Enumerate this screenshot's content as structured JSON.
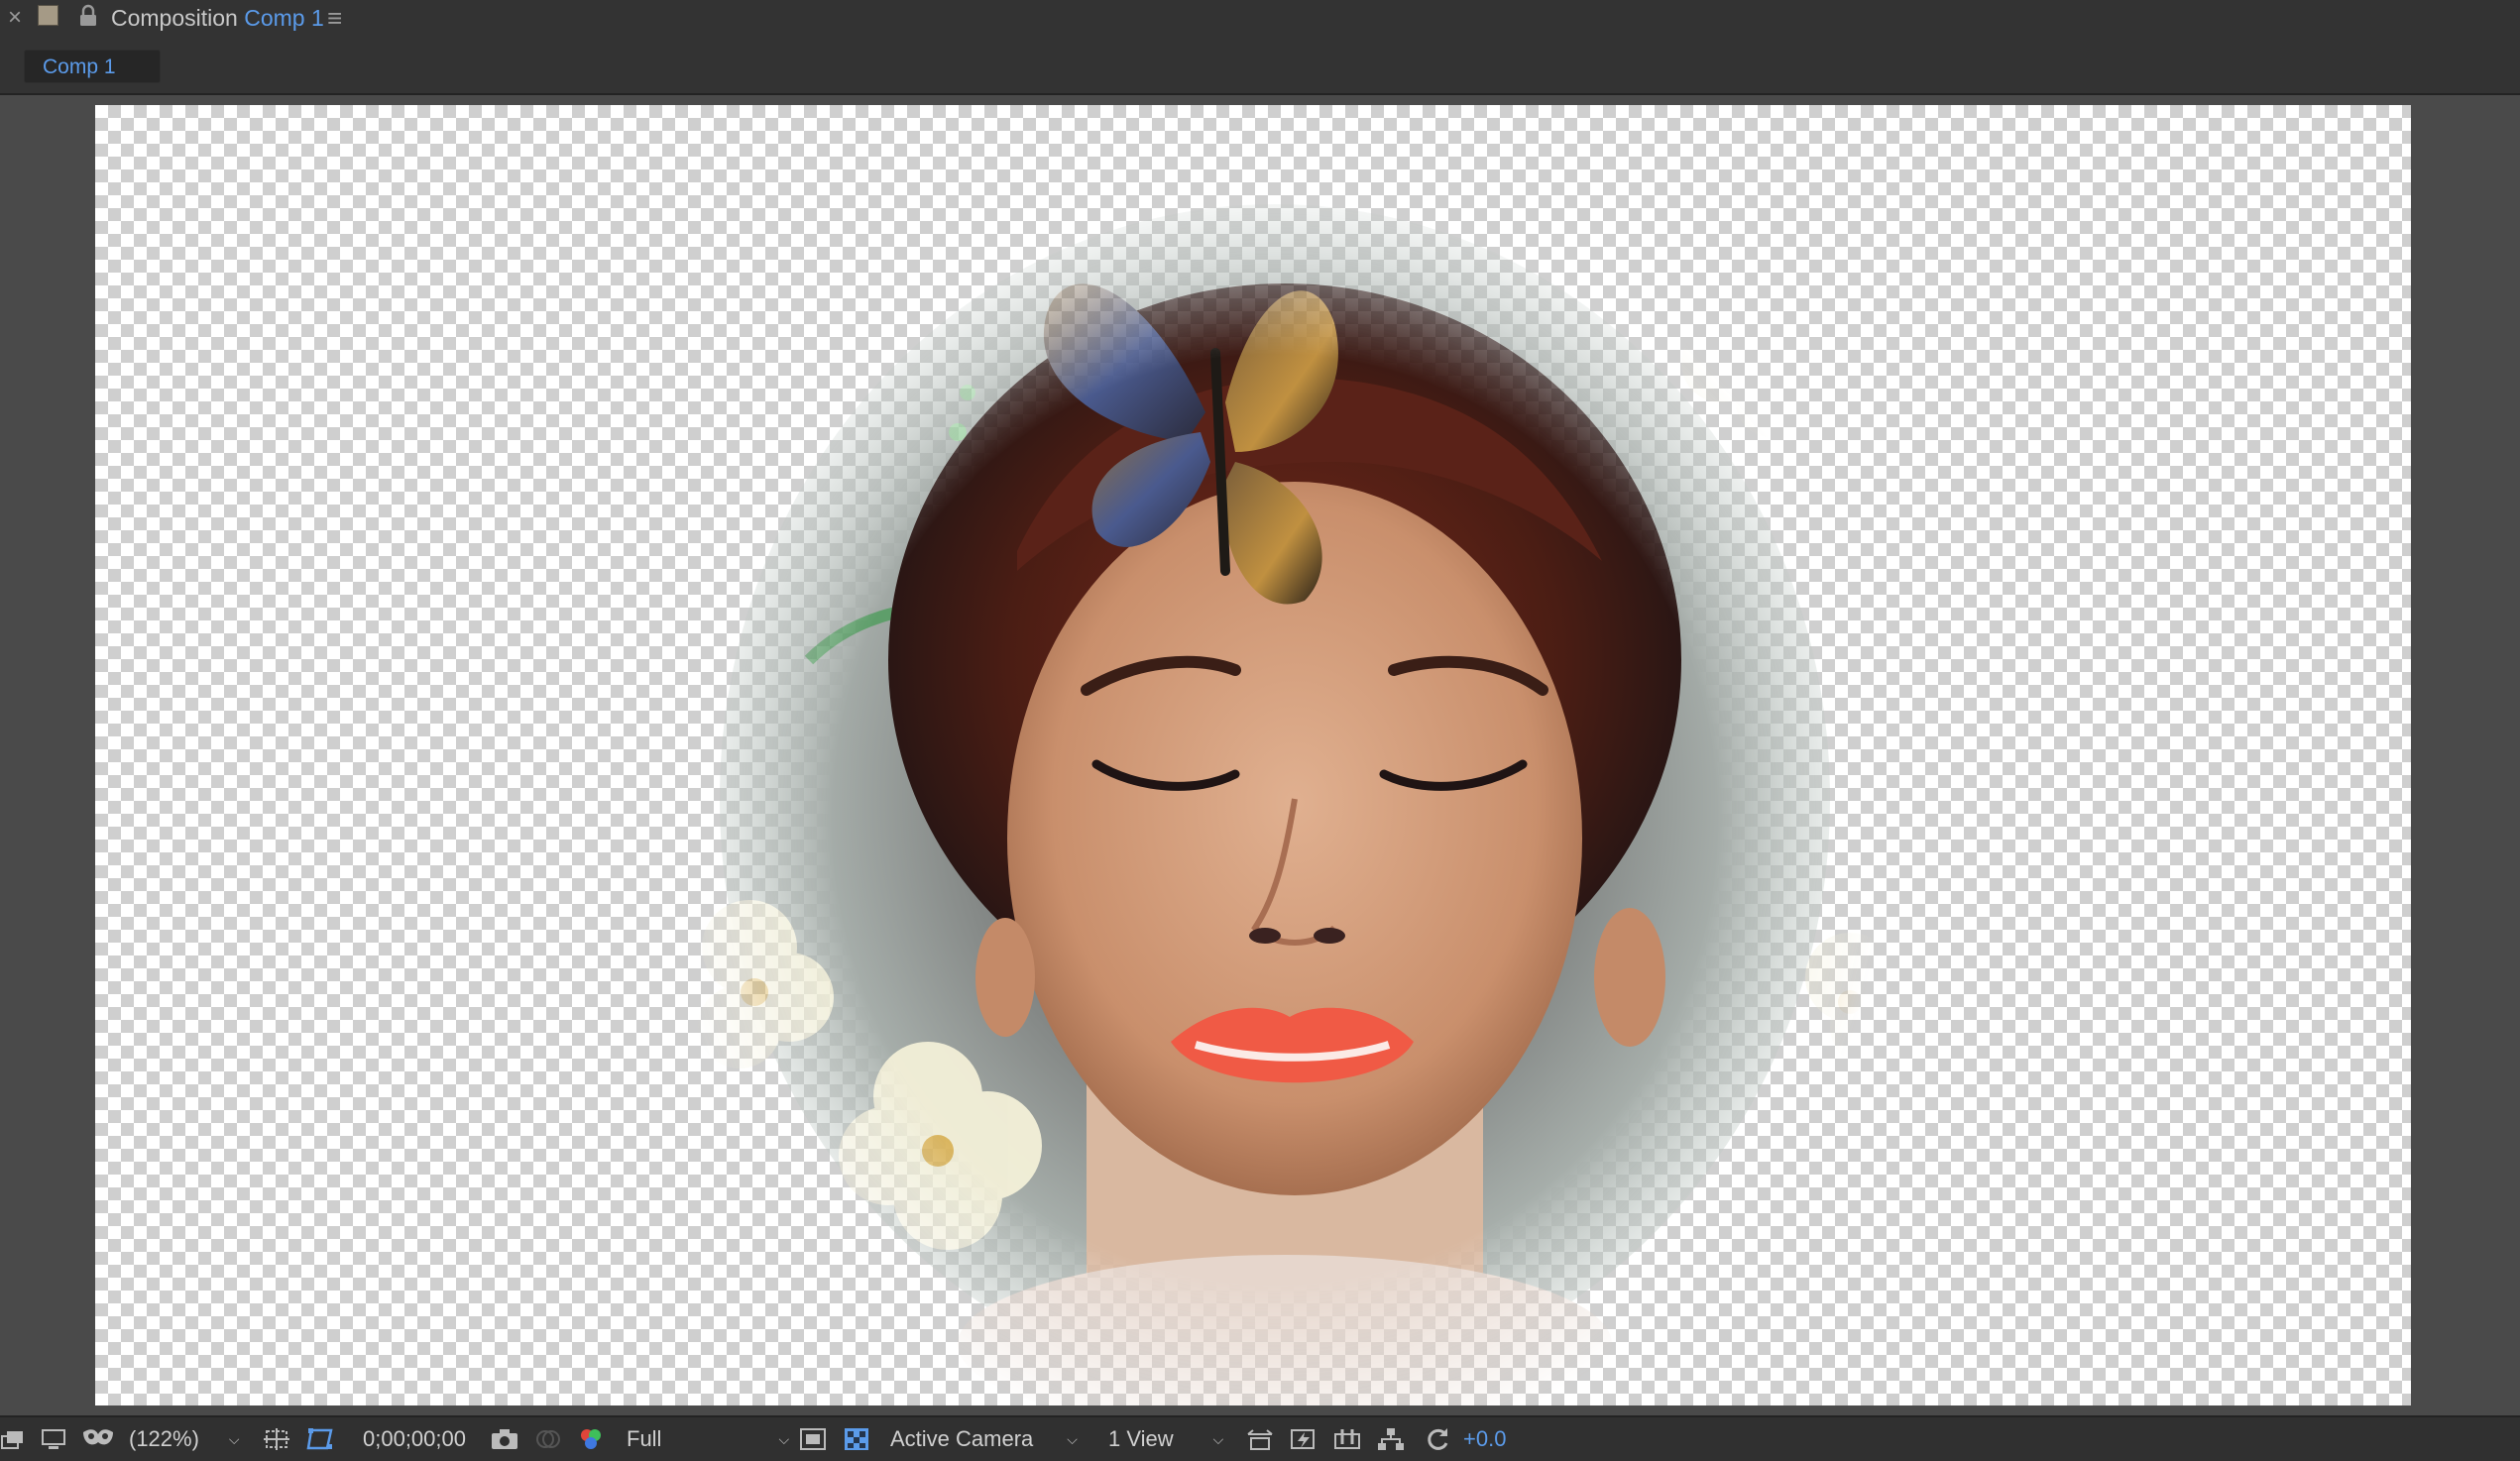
{
  "panel": {
    "close_glyph": "×",
    "swatch_color": "#a59a86",
    "title_prefix": "Composition",
    "title_comp": "Comp 1",
    "menu_glyph": "≡"
  },
  "tabs": [
    {
      "label": "Comp 1",
      "active": true
    }
  ],
  "viewer": {
    "background": "transparency-checkerboard",
    "content": "portrait-woman-butterfly-flowers-vignette"
  },
  "toolbar": {
    "magnification": "(122%)",
    "timecode": "0;00;00;00",
    "resolution": "Full",
    "camera": "Active Camera",
    "view_layout": "1 View",
    "exposure": "+0.0",
    "icons": [
      "always-preview-icon",
      "monitor-icon",
      "mask-toggle-icon",
      "grid-guides-icon",
      "mask-path-icon",
      "snapshot-icon",
      "show-snapshot-icon",
      "color-channels-icon",
      "region-of-interest-icon",
      "transparency-grid-icon",
      "reset-view-icon",
      "fast-previews-icon",
      "timeline-icon",
      "flowchart-icon",
      "reset-exposure-icon"
    ]
  }
}
